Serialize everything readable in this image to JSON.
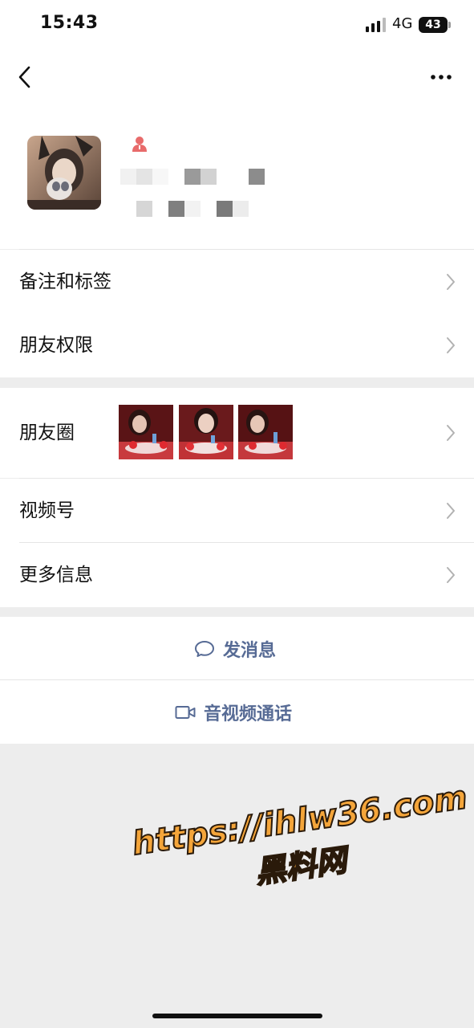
{
  "status_bar": {
    "time": "15:43",
    "network": "4G",
    "battery": "43"
  },
  "nav": {
    "back_icon": "chevron-left-icon",
    "more_icon": "ellipsis-icon"
  },
  "menu": {
    "remark_tags": "备注和标签",
    "friend_permissions": "朋友权限",
    "moments": "朋友圈",
    "channels": "视频号",
    "more_info": "更多信息"
  },
  "actions": {
    "send_message": "发消息",
    "call": "音视频通话"
  },
  "watermark": {
    "url": "https://ihlw36.com",
    "name": "黑料网"
  },
  "colors": {
    "link": "#576b95",
    "background": "#ededed",
    "profile_icon": "#e86b6b",
    "watermark": "#f4a53a"
  }
}
